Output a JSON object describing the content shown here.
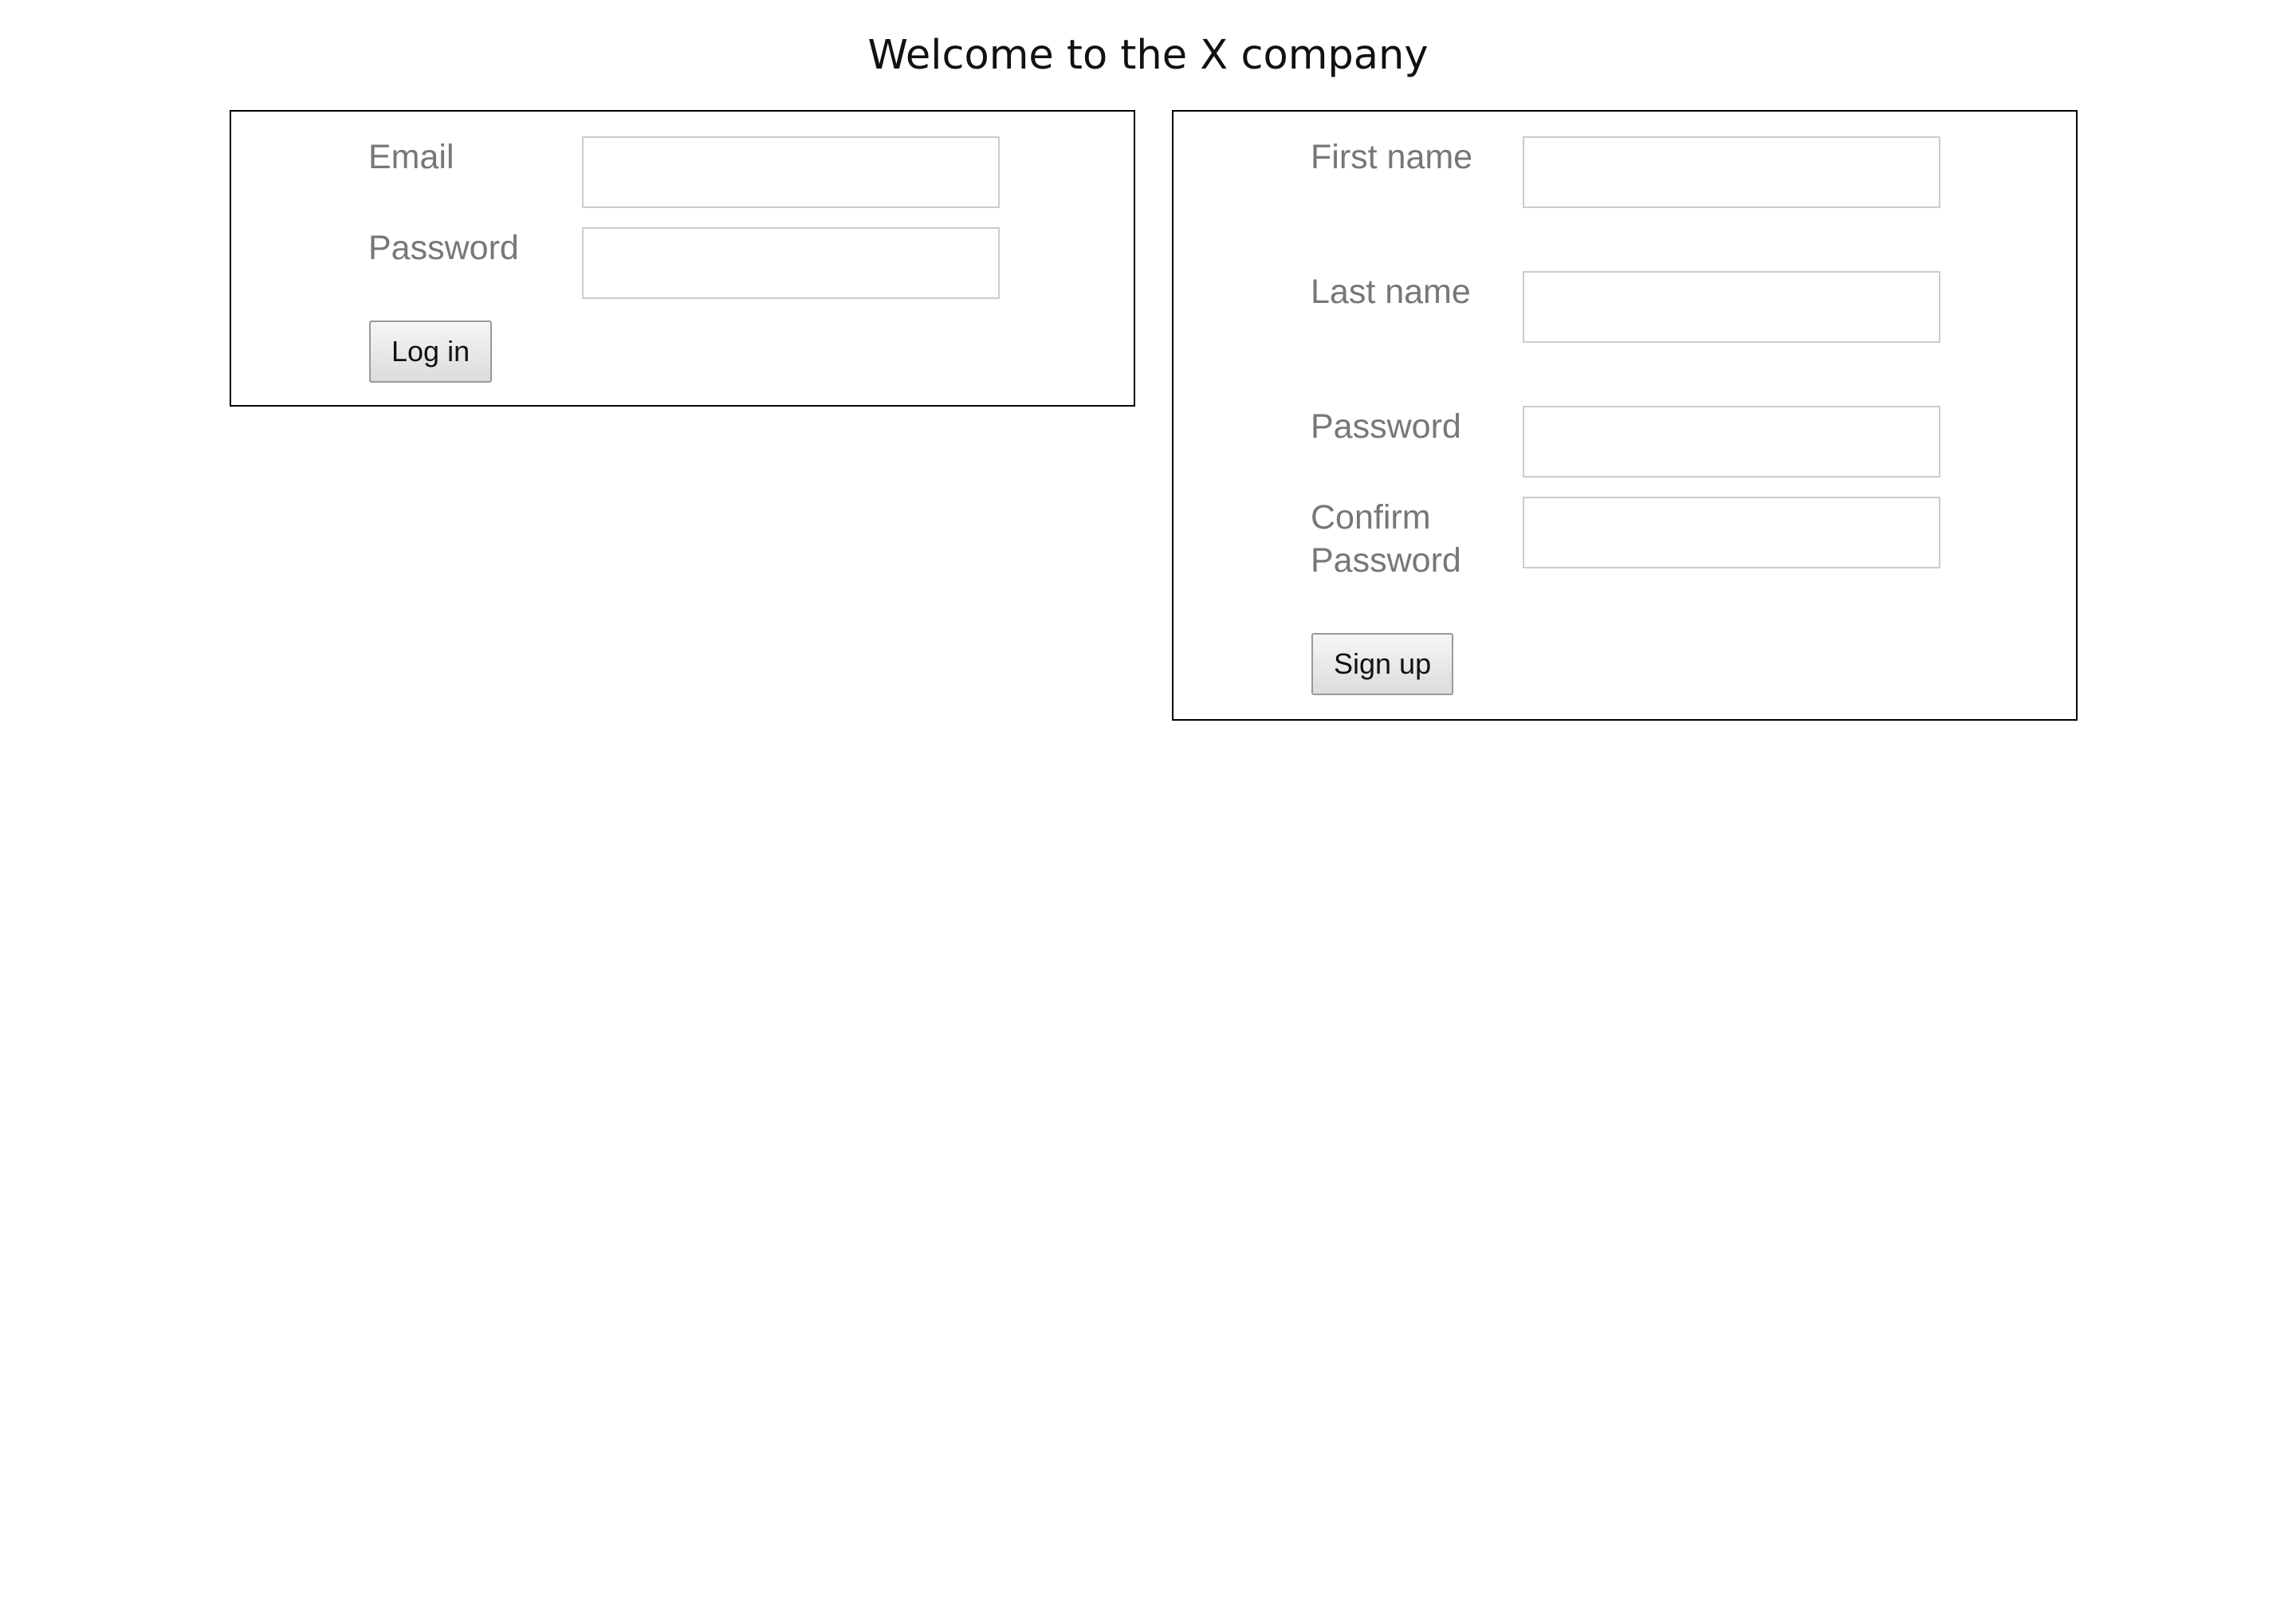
{
  "header": {
    "title": "Welcome to the X company"
  },
  "login_form": {
    "email_label": "Email",
    "email_value": "",
    "password_label": "Password",
    "password_value": "",
    "submit_label": "Log in"
  },
  "signup_form": {
    "first_name_label": "First name",
    "first_name_value": "",
    "last_name_label": "Last name",
    "last_name_value": "",
    "password_label": "Password",
    "password_value": "",
    "confirm_password_label": "Confirm Password",
    "confirm_password_value": "",
    "submit_label": "Sign up"
  }
}
